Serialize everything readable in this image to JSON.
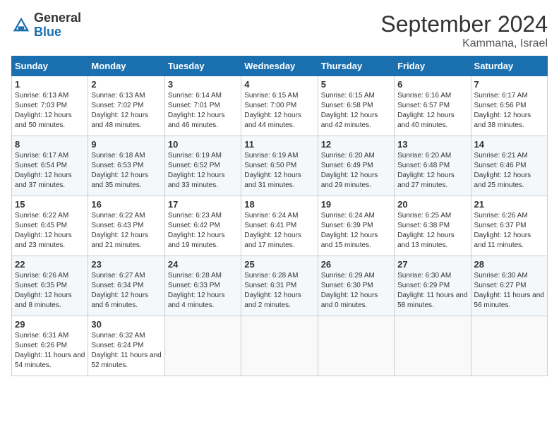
{
  "header": {
    "logo_general": "General",
    "logo_blue": "Blue",
    "month_title": "September 2024",
    "location": "Kammana, Israel"
  },
  "days_of_week": [
    "Sunday",
    "Monday",
    "Tuesday",
    "Wednesday",
    "Thursday",
    "Friday",
    "Saturday"
  ],
  "weeks": [
    [
      {
        "day": "1",
        "sunrise": "6:13 AM",
        "sunset": "7:03 PM",
        "daylight": "12 hours and 50 minutes."
      },
      {
        "day": "2",
        "sunrise": "6:13 AM",
        "sunset": "7:02 PM",
        "daylight": "12 hours and 48 minutes."
      },
      {
        "day": "3",
        "sunrise": "6:14 AM",
        "sunset": "7:01 PM",
        "daylight": "12 hours and 46 minutes."
      },
      {
        "day": "4",
        "sunrise": "6:15 AM",
        "sunset": "7:00 PM",
        "daylight": "12 hours and 44 minutes."
      },
      {
        "day": "5",
        "sunrise": "6:15 AM",
        "sunset": "6:58 PM",
        "daylight": "12 hours and 42 minutes."
      },
      {
        "day": "6",
        "sunrise": "6:16 AM",
        "sunset": "6:57 PM",
        "daylight": "12 hours and 40 minutes."
      },
      {
        "day": "7",
        "sunrise": "6:17 AM",
        "sunset": "6:56 PM",
        "daylight": "12 hours and 38 minutes."
      }
    ],
    [
      {
        "day": "8",
        "sunrise": "6:17 AM",
        "sunset": "6:54 PM",
        "daylight": "12 hours and 37 minutes."
      },
      {
        "day": "9",
        "sunrise": "6:18 AM",
        "sunset": "6:53 PM",
        "daylight": "12 hours and 35 minutes."
      },
      {
        "day": "10",
        "sunrise": "6:19 AM",
        "sunset": "6:52 PM",
        "daylight": "12 hours and 33 minutes."
      },
      {
        "day": "11",
        "sunrise": "6:19 AM",
        "sunset": "6:50 PM",
        "daylight": "12 hours and 31 minutes."
      },
      {
        "day": "12",
        "sunrise": "6:20 AM",
        "sunset": "6:49 PM",
        "daylight": "12 hours and 29 minutes."
      },
      {
        "day": "13",
        "sunrise": "6:20 AM",
        "sunset": "6:48 PM",
        "daylight": "12 hours and 27 minutes."
      },
      {
        "day": "14",
        "sunrise": "6:21 AM",
        "sunset": "6:46 PM",
        "daylight": "12 hours and 25 minutes."
      }
    ],
    [
      {
        "day": "15",
        "sunrise": "6:22 AM",
        "sunset": "6:45 PM",
        "daylight": "12 hours and 23 minutes."
      },
      {
        "day": "16",
        "sunrise": "6:22 AM",
        "sunset": "6:43 PM",
        "daylight": "12 hours and 21 minutes."
      },
      {
        "day": "17",
        "sunrise": "6:23 AM",
        "sunset": "6:42 PM",
        "daylight": "12 hours and 19 minutes."
      },
      {
        "day": "18",
        "sunrise": "6:24 AM",
        "sunset": "6:41 PM",
        "daylight": "12 hours and 17 minutes."
      },
      {
        "day": "19",
        "sunrise": "6:24 AM",
        "sunset": "6:39 PM",
        "daylight": "12 hours and 15 minutes."
      },
      {
        "day": "20",
        "sunrise": "6:25 AM",
        "sunset": "6:38 PM",
        "daylight": "12 hours and 13 minutes."
      },
      {
        "day": "21",
        "sunrise": "6:26 AM",
        "sunset": "6:37 PM",
        "daylight": "12 hours and 11 minutes."
      }
    ],
    [
      {
        "day": "22",
        "sunrise": "6:26 AM",
        "sunset": "6:35 PM",
        "daylight": "12 hours and 8 minutes."
      },
      {
        "day": "23",
        "sunrise": "6:27 AM",
        "sunset": "6:34 PM",
        "daylight": "12 hours and 6 minutes."
      },
      {
        "day": "24",
        "sunrise": "6:28 AM",
        "sunset": "6:33 PM",
        "daylight": "12 hours and 4 minutes."
      },
      {
        "day": "25",
        "sunrise": "6:28 AM",
        "sunset": "6:31 PM",
        "daylight": "12 hours and 2 minutes."
      },
      {
        "day": "26",
        "sunrise": "6:29 AM",
        "sunset": "6:30 PM",
        "daylight": "12 hours and 0 minutes."
      },
      {
        "day": "27",
        "sunrise": "6:30 AM",
        "sunset": "6:29 PM",
        "daylight": "11 hours and 58 minutes."
      },
      {
        "day": "28",
        "sunrise": "6:30 AM",
        "sunset": "6:27 PM",
        "daylight": "11 hours and 56 minutes."
      }
    ],
    [
      {
        "day": "29",
        "sunrise": "6:31 AM",
        "sunset": "6:26 PM",
        "daylight": "11 hours and 54 minutes."
      },
      {
        "day": "30",
        "sunrise": "6:32 AM",
        "sunset": "6:24 PM",
        "daylight": "11 hours and 52 minutes."
      },
      null,
      null,
      null,
      null,
      null
    ]
  ]
}
